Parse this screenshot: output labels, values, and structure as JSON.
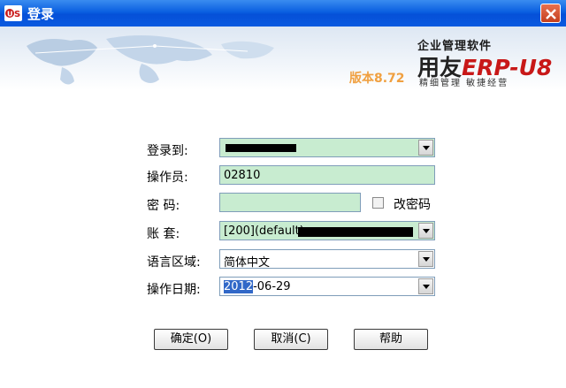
{
  "window": {
    "title": "登录",
    "app_icon": "ufida-u8-icon",
    "close_icon": "close-icon"
  },
  "banner": {
    "slogan": "企业管理软件",
    "logo_prefix": "用友",
    "logo_erp": "ERP-U8",
    "version": "版本8.72",
    "motto": "精细管理   敏捷经营"
  },
  "form": {
    "login_to_label": "登录到:",
    "login_to_value": "",
    "operator_label": "操作员:",
    "operator_value": "02810",
    "password_label": "密  码:",
    "password_value": "",
    "change_password_label": "改密码",
    "account_label": "账  套:",
    "account_value": "[200](default)",
    "language_label": "语言区域:",
    "language_value": "简体中文",
    "date_label": "操作日期:",
    "date_year": "2012",
    "date_rest": "-06-29"
  },
  "buttons": {
    "ok": "确定(O)",
    "cancel": "取消(C)",
    "help": "帮助"
  },
  "colors": {
    "titlebar": "#0a5fe0",
    "field_bg": "#c8ecd0",
    "logo_red": "#c81818",
    "version_orange": "#f0a040"
  }
}
